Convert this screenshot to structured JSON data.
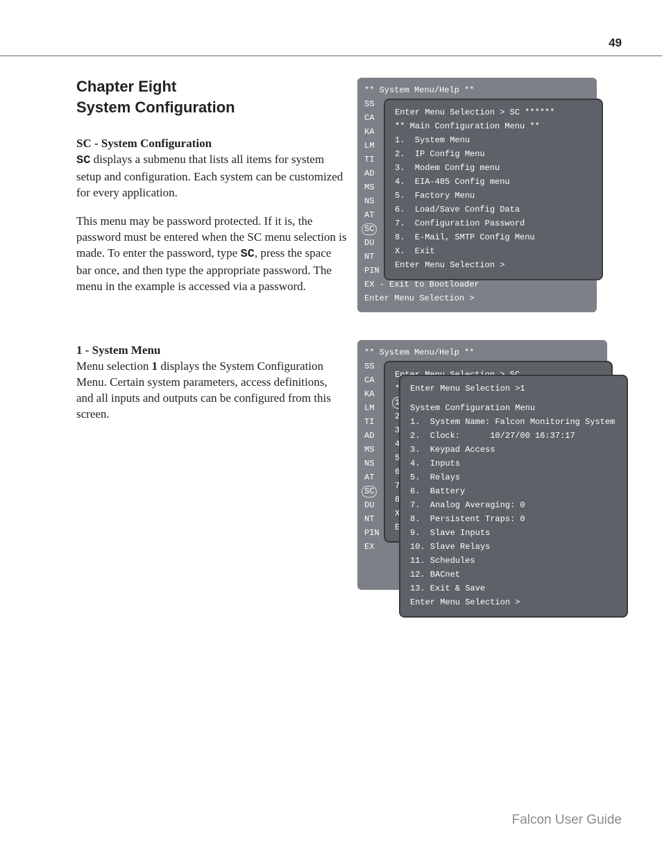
{
  "page_number": "49",
  "chapter_line1": "Chapter Eight",
  "chapter_line2": "System Configuration",
  "sc": {
    "heading": "SC - System Configuration",
    "code": "SC",
    "p1a": " displays a submenu that lists all items for system setup and configuration.  Each system can be customized for every application.",
    "p2a": "This menu may be password protected.  If it is, the password must be entered when the SC menu selection is made.  To enter the password, type ",
    "p2b": ", press the space bar once, and then type the appropriate password.  The menu in the example is accessed via a password."
  },
  "sm": {
    "heading": "1 - System Menu",
    "p1a": "Menu selection ",
    "bold1": "1",
    "p1b": " displays the System Configuration Menu.  Certain system parameters, access definitions, and all inputs and outputs can be configured from this screen."
  },
  "term1": {
    "base": {
      "l0": "** System Menu/Help **",
      "items": [
        "SS",
        "CA",
        "KA",
        "LM",
        "TI",
        "AD",
        "MS",
        "NS",
        "AT",
        "SC",
        "DU",
        "NT",
        "PIN"
      ],
      "ex": "EX - Exit to Bootloader",
      "prompt": "Enter Menu Selection >"
    },
    "overlay": {
      "l0": "Enter Menu Selection > SC ******",
      "l1": "** Main Configuration Menu **",
      "l2": "1.  System Menu",
      "l3": "2.  IP Config Menu",
      "l4": "3.  Modem Config menu",
      "l5": "4.  EIA-485 Config menu",
      "l6": "5.  Factory Menu",
      "l7": "6.  Load/Save Config Data",
      "l8": "7.  Configuration Password",
      "l9": "8.  E-Mail, SMTP Config Menu",
      "l10": "X.  Exit",
      "l11": "Enter Menu Selection >"
    }
  },
  "term2": {
    "base": {
      "l0": "** System Menu/Help **",
      "items": [
        "SS",
        "CA",
        "KA",
        "LM",
        "TI",
        "AD",
        "MS",
        "NS",
        "AT",
        "SC",
        "DU",
        "NT",
        "PIN",
        "EX"
      ]
    },
    "overlay1": {
      "l0": "Enter Menu Selection > SC",
      "l1": "**",
      "nums": [
        "1.",
        "2.",
        "3.",
        "4.",
        "5.",
        "6.",
        "7.",
        "8.",
        "X.",
        "Ent"
      ]
    },
    "overlay2": {
      "l0": "Enter Menu Selection >1",
      "l1": "System Configuration Menu",
      "l2": "1.  System Name: Falcon Monitoring System",
      "l3": "2.  Clock:      10/27/00 16:37:17",
      "l4": "3.  Keypad Access",
      "l5": "4.  Inputs",
      "l6": "5.  Relays",
      "l7": "6.  Battery",
      "l8": "7.  Analog Averaging: 0",
      "l9": "8.  Persistent Traps: 0",
      "l10": "9.  Slave Inputs",
      "l11": "10. Slave Relays",
      "l12": "11. Schedules",
      "l13": "12. BACnet",
      "l14": "13. Exit & Save",
      "l15": "Enter Menu Selection >"
    }
  },
  "footer": "Falcon User Guide"
}
